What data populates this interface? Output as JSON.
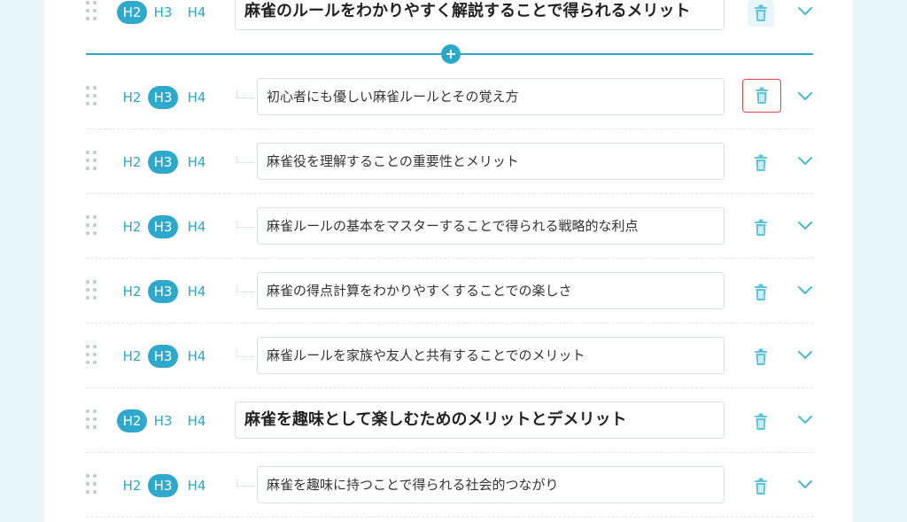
{
  "level_labels": {
    "h2": "H2",
    "h3": "H3",
    "h4": "H4"
  },
  "colors": {
    "accent": "#2ea9cc",
    "focus_outline": "#d9464e",
    "background": "#e9f6f7"
  },
  "rows": [
    {
      "level": "H2",
      "text": "麻雀のルールをわかりやすく解説することで得られるメリット"
    },
    {
      "level": "H3",
      "text": "初心者にも優しい麻雀ルールとその覚え方"
    },
    {
      "level": "H3",
      "text": "麻雀役を理解することの重要性とメリット"
    },
    {
      "level": "H3",
      "text": "麻雀ルールの基本をマスターすることで得られる戦略的な利点"
    },
    {
      "level": "H3",
      "text": "麻雀の得点計算をわかりやすくすることでの楽しさ"
    },
    {
      "level": "H3",
      "text": "麻雀ルールを家族や友人と共有することでのメリット"
    },
    {
      "level": "H2",
      "text": "麻雀を趣味として楽しむためのメリットとデメリット"
    },
    {
      "level": "H3",
      "text": "麻雀を趣味に持つことで得られる社会的つながり"
    }
  ],
  "icons": {
    "drag": "drag-handle-icon",
    "delete": "trash-icon",
    "expand": "chevron-down-icon",
    "insert": "plus-circle-icon"
  }
}
